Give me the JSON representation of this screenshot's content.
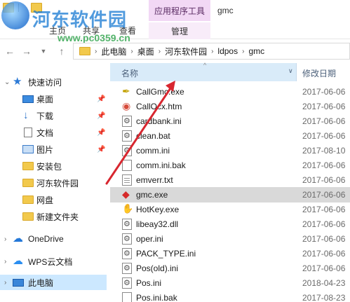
{
  "ribbon": {
    "context_tab_header": "应用程序工具",
    "window_title": "gmc",
    "tabs": [
      "主页",
      "共享",
      "查看"
    ],
    "context_tab": "管理"
  },
  "watermark": {
    "title": "河东软件园",
    "url": "www.pc0359.cn"
  },
  "address": {
    "crumbs": [
      "此电脑",
      "桌面",
      "河东软件园",
      "ldpos",
      "gmc"
    ]
  },
  "navpane": {
    "quick_access": "快速访问",
    "items": [
      {
        "label": "桌面",
        "icon": "desktop-icon",
        "pinned": true
      },
      {
        "label": "下载",
        "icon": "download-icon",
        "pinned": true
      },
      {
        "label": "文档",
        "icon": "document-icon",
        "pinned": true
      },
      {
        "label": "图片",
        "icon": "pictures-icon",
        "pinned": true
      },
      {
        "label": "安装包",
        "icon": "folder-icon",
        "pinned": false
      },
      {
        "label": "河东软件园",
        "icon": "folder-icon",
        "pinned": false
      },
      {
        "label": "网盘",
        "icon": "folder-icon",
        "pinned": false
      },
      {
        "label": "新建文件夹",
        "icon": "folder-icon",
        "pinned": false
      }
    ],
    "onedrive": "OneDrive",
    "wps": "WPS云文档",
    "this_pc": "此电脑"
  },
  "columns": {
    "name": "名称",
    "date": "修改日期"
  },
  "files": [
    {
      "name": "CallGmc.exe",
      "date": "2017-06-06",
      "icon": "callgmc-exe-icon"
    },
    {
      "name": "CallOcx.htm",
      "date": "2017-06-06",
      "icon": "html-file-icon"
    },
    {
      "name": "cardbank.ini",
      "date": "2017-06-06",
      "icon": "config-file-icon"
    },
    {
      "name": "clean.bat",
      "date": "2017-06-06",
      "icon": "batch-file-icon"
    },
    {
      "name": "comm.ini",
      "date": "2017-08-10",
      "icon": "config-file-icon"
    },
    {
      "name": "comm.ini.bak",
      "date": "2017-06-06",
      "icon": "file-icon"
    },
    {
      "name": "emverr.txt",
      "date": "2017-06-06",
      "icon": "text-file-icon"
    },
    {
      "name": "gmc.exe",
      "date": "2017-06-06",
      "icon": "gmc-exe-icon",
      "selected": true
    },
    {
      "name": "HotKey.exe",
      "date": "2017-06-06",
      "icon": "hotkey-exe-icon"
    },
    {
      "name": "libeay32.dll",
      "date": "2017-06-06",
      "icon": "dll-file-icon"
    },
    {
      "name": "oper.ini",
      "date": "2017-06-06",
      "icon": "config-file-icon"
    },
    {
      "name": "PACK_TYPE.ini",
      "date": "2017-06-06",
      "icon": "config-file-icon"
    },
    {
      "name": "Pos(old).ini",
      "date": "2017-06-06",
      "icon": "config-file-icon"
    },
    {
      "name": "Pos.ini",
      "date": "2018-04-23",
      "icon": "config-file-icon"
    },
    {
      "name": "Pos.ini.bak",
      "date": "2017-08-23",
      "icon": "file-icon"
    }
  ]
}
